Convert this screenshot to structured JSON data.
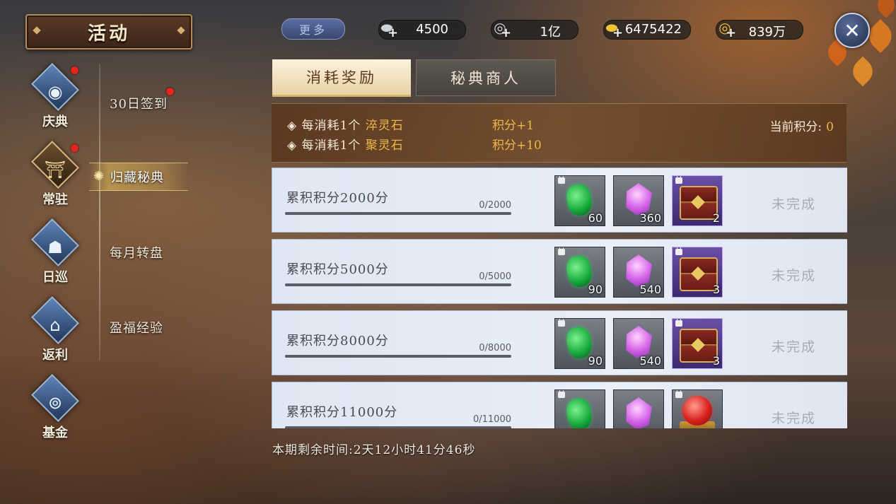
{
  "title": "活动",
  "header": {
    "more_label": "更多",
    "currencies": [
      {
        "icon": "silver-ingot-icon",
        "value": "4500"
      },
      {
        "icon": "silver-coin-icon",
        "value": "1亿"
      },
      {
        "icon": "gold-ingot-icon",
        "value": "6475422"
      },
      {
        "icon": "gold-coin-icon",
        "value": "839万"
      }
    ],
    "close_icon": "close-swords-icon"
  },
  "sidebar": {
    "categories": [
      {
        "label": "庆典",
        "icon": "celebration-icon",
        "red_dot": true
      },
      {
        "label": "常驻",
        "icon": "palace-gate-icon",
        "red_dot": true
      },
      {
        "label": "日巡",
        "icon": "patrol-icon",
        "red_dot": false
      },
      {
        "label": "返利",
        "icon": "rebate-pavilion-icon",
        "red_dot": false
      },
      {
        "label": "基金",
        "icon": "fund-coin-icon",
        "red_dot": false
      }
    ],
    "sub_items": [
      {
        "label": "30日签到",
        "red_dot": true
      },
      {
        "label": "归藏秘典",
        "active": true
      },
      {
        "label": "每月转盘"
      },
      {
        "label": "盈福经验"
      }
    ]
  },
  "tabs": [
    {
      "label": "消耗奖励",
      "active": true
    },
    {
      "label": "秘典商人",
      "active": false
    }
  ],
  "rules": [
    {
      "prefix": "每消耗1个",
      "item": "淬灵石",
      "points": "积分+1"
    },
    {
      "prefix": "每消耗1个",
      "item": "聚灵石",
      "points": "积分+10"
    }
  ],
  "current_score": {
    "label": "当前积分:",
    "value": "0"
  },
  "tasks": [
    {
      "name": "累积积分2000分",
      "progress_text": "0/2000",
      "progress": 0,
      "status": "未完成",
      "rewards": [
        {
          "type": "green-gem",
          "count": "60",
          "locked": true
        },
        {
          "type": "pink-crystal",
          "count": "360",
          "locked": false
        },
        {
          "type": "treasure-chest",
          "count": "2",
          "locked": true
        }
      ]
    },
    {
      "name": "累积积分5000分",
      "progress_text": "0/5000",
      "progress": 0,
      "status": "未完成",
      "rewards": [
        {
          "type": "green-gem",
          "count": "90",
          "locked": true
        },
        {
          "type": "pink-crystal",
          "count": "540",
          "locked": false
        },
        {
          "type": "treasure-chest",
          "count": "3",
          "locked": true
        }
      ]
    },
    {
      "name": "累积积分8000分",
      "progress_text": "0/8000",
      "progress": 0,
      "status": "未完成",
      "rewards": [
        {
          "type": "green-gem",
          "count": "90",
          "locked": true
        },
        {
          "type": "pink-crystal",
          "count": "540",
          "locked": false
        },
        {
          "type": "treasure-chest",
          "count": "3",
          "locked": true
        }
      ]
    },
    {
      "name": "累积积分11000分",
      "progress_text": "0/11000",
      "progress": 0,
      "status": "未完成",
      "rewards": [
        {
          "type": "green-gem",
          "count": "",
          "locked": true
        },
        {
          "type": "pink-crystal",
          "count": "",
          "locked": false
        },
        {
          "type": "red-orb-box",
          "count": "",
          "locked": true
        }
      ]
    }
  ],
  "timer": "本期剩余时间:2天12小时41分46秒"
}
